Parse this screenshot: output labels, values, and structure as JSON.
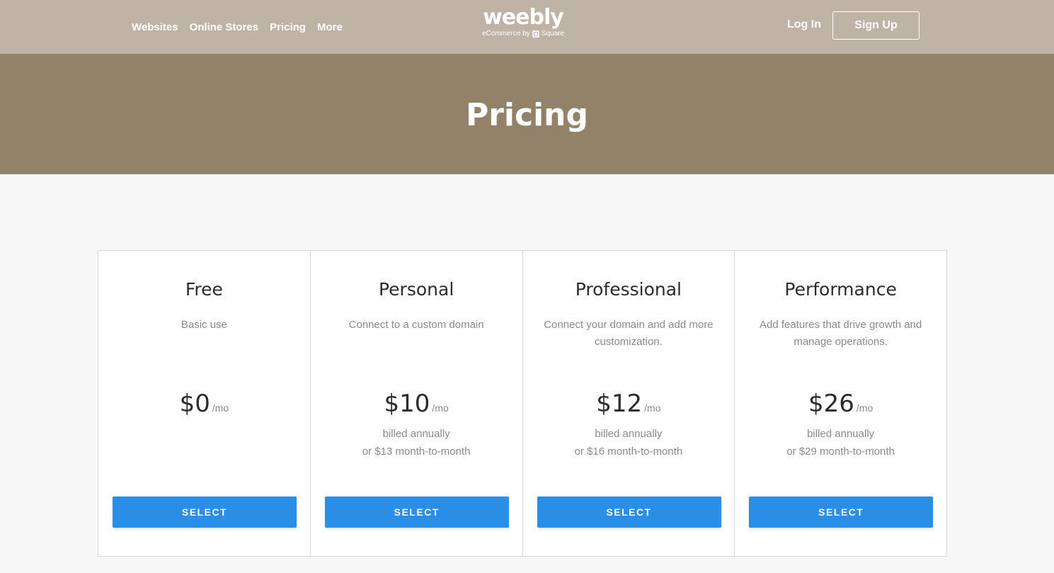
{
  "nav": {
    "links": [
      "Websites",
      "Online Stores",
      "Pricing",
      "More"
    ],
    "logo": {
      "word": "weebly",
      "sub_prefix": "eCommerce by",
      "sub_brand": "Square"
    },
    "login": "Log In",
    "signup": "Sign Up"
  },
  "hero": {
    "title": "Pricing"
  },
  "plans": [
    {
      "name": "Free",
      "desc": "Basic use",
      "price": "$0",
      "unit": "/mo",
      "billing_1": "",
      "billing_2": "",
      "cta": "SELECT"
    },
    {
      "name": "Personal",
      "desc": "Connect to a custom domain",
      "price": "$10",
      "unit": "/mo",
      "billing_1": "billed annually",
      "billing_2": "or $13 month-to-month",
      "cta": "SELECT"
    },
    {
      "name": "Professional",
      "desc": "Connect your domain and add more customization.",
      "price": "$12",
      "unit": "/mo",
      "billing_1": "billed annually",
      "billing_2": "or $16 month-to-month",
      "cta": "SELECT"
    },
    {
      "name": "Performance",
      "desc": "Add features that drive growth and manage operations.",
      "price": "$26",
      "unit": "/mo",
      "billing_1": "billed annually",
      "billing_2": "or $29 month-to-month",
      "cta": "SELECT"
    }
  ],
  "colors": {
    "nav_bg": "#bfb3a6",
    "hero_bg": "#93826a",
    "button": "#2a8ee6",
    "page_bg": "#f7f7f7"
  }
}
